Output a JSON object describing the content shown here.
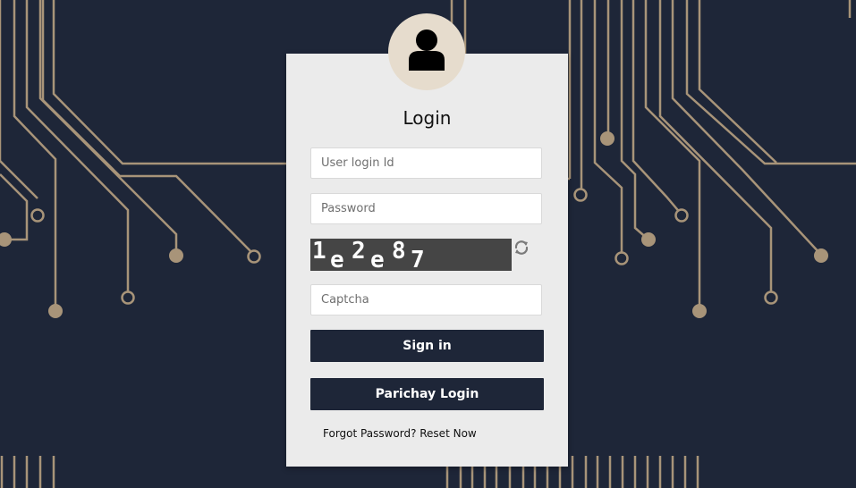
{
  "login": {
    "title": "Login",
    "user_id_placeholder": "User login Id",
    "password_placeholder": "Password",
    "captcha_text": "1e2e87",
    "captcha_placeholder": "Captcha",
    "sign_in_label": "Sign in",
    "parichay_label": "Parichay Login",
    "forgot_label": "Forgot Password? Reset Now"
  },
  "icons": {
    "avatar": "user-silhouette-icon",
    "refresh": "refresh-icon"
  },
  "colors": {
    "background": "#1e2638",
    "circuit": "#a89479",
    "card": "#ebebeb",
    "button": "#1e2638",
    "avatar_bg": "#e6dccd"
  }
}
